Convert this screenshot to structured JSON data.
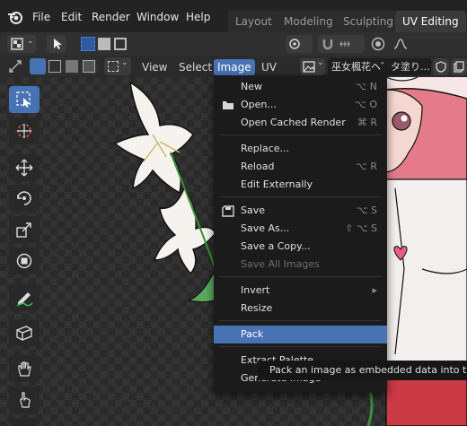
{
  "topbar": {
    "menus": [
      "File",
      "Edit",
      "Render",
      "Window",
      "Help"
    ],
    "workspaces": [
      "Layout",
      "Modeling",
      "Sculpting",
      "UV Editing"
    ]
  },
  "header": {
    "menus": [
      "View",
      "Select",
      "Image",
      "UV"
    ],
    "image_name": "巫女楓花ヘ゛タ塗り..."
  },
  "dropdown": {
    "items": [
      {
        "label": "New",
        "shortcut": "⌥ N"
      },
      {
        "label": "Open...",
        "shortcut": "⌥ O"
      },
      {
        "label": "Open Cached Render",
        "shortcut": "⌘ R"
      },
      {
        "label": "Replace...",
        "shortcut": ""
      },
      {
        "label": "Reload",
        "shortcut": "⌥ R"
      },
      {
        "label": "Edit Externally",
        "shortcut": ""
      },
      {
        "label": "Save",
        "shortcut": "⌥ S"
      },
      {
        "label": "Save As...",
        "shortcut": "⇧ ⌥ S"
      },
      {
        "label": "Save a Copy...",
        "shortcut": ""
      },
      {
        "label": "Save All Images",
        "shortcut": ""
      },
      {
        "label": "Invert",
        "shortcut": "▸"
      },
      {
        "label": "Resize",
        "shortcut": ""
      },
      {
        "label": "Pack",
        "shortcut": ""
      },
      {
        "label": "Extract Palette",
        "shortcut": ""
      },
      {
        "label": "Generate Image",
        "shortcut": ""
      }
    ]
  },
  "tooltip": {
    "text": "Pack an image as embedded data into the .b"
  },
  "colors": {
    "accent": "#4772b3",
    "menu_bg": "#1b1b1b"
  }
}
